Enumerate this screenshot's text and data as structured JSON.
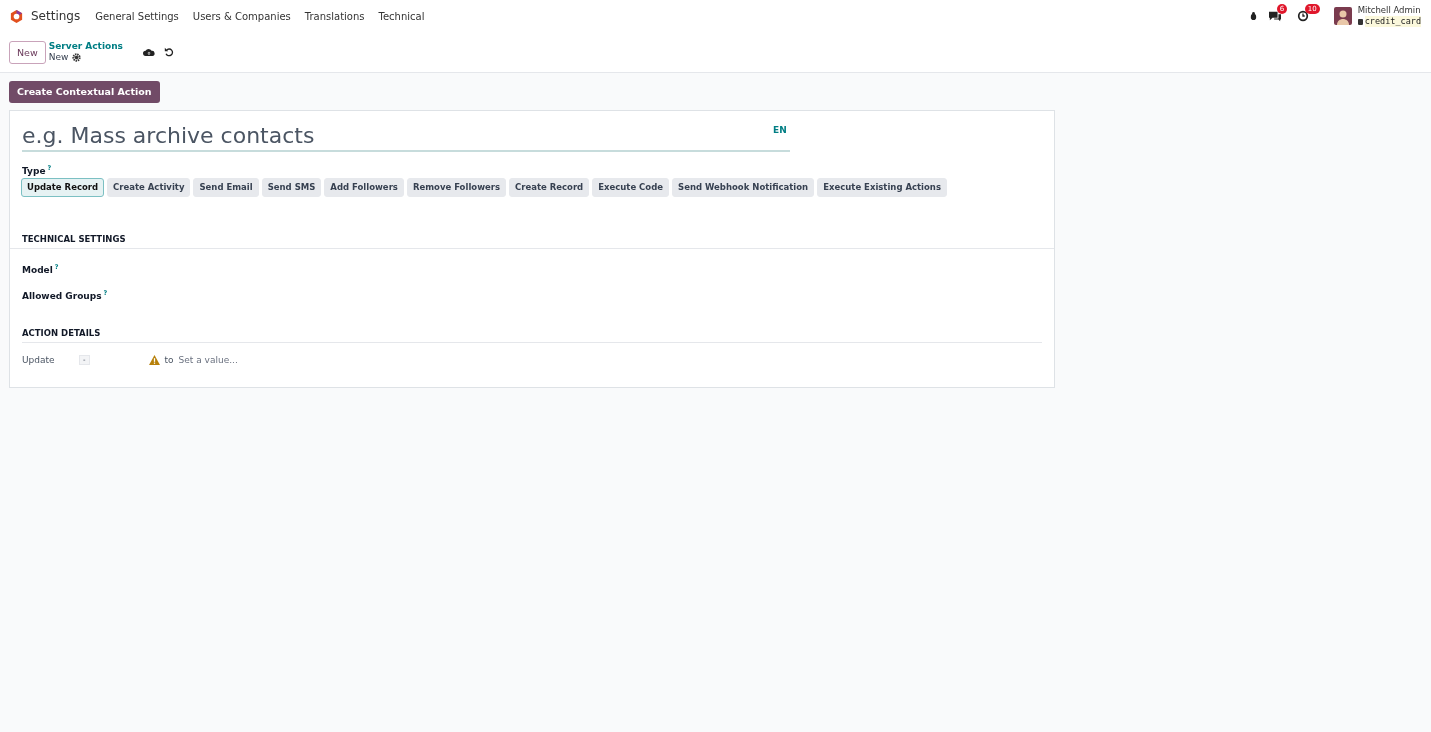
{
  "navbar": {
    "app_name": "Settings",
    "menu": [
      "General Settings",
      "Users & Companies",
      "Translations",
      "Technical"
    ],
    "messages_badge": "6",
    "activities_badge": "10",
    "user_name": "Mitchell Admin",
    "database": "credit_card"
  },
  "control_panel": {
    "new_button": "New",
    "breadcrumb": "Server Actions",
    "record": "New"
  },
  "contextual_button": "Create Contextual Action",
  "form": {
    "name_placeholder": "e.g. Mass archive contacts",
    "lang": "EN",
    "type_label": "Type",
    "help": "?",
    "types": [
      {
        "label": "Update Record",
        "selected": true
      },
      {
        "label": "Create Activity",
        "selected": false
      },
      {
        "label": "Send Email",
        "selected": false
      },
      {
        "label": "Send SMS",
        "selected": false
      },
      {
        "label": "Add Followers",
        "selected": false
      },
      {
        "label": "Remove Followers",
        "selected": false
      },
      {
        "label": "Create Record",
        "selected": false
      },
      {
        "label": "Execute Code",
        "selected": false
      },
      {
        "label": "Send Webhook Notification",
        "selected": false
      },
      {
        "label": "Execute Existing Actions",
        "selected": false
      }
    ],
    "technical_title": "TECHNICAL SETTINGS",
    "technical_fields": [
      {
        "label": "Model",
        "help": "?"
      },
      {
        "label": "Allowed Groups",
        "help": "?"
      }
    ],
    "details_title": "ACTION DETAILS",
    "update_label": "Update",
    "update_select": "-",
    "to": "to",
    "value_placeholder": "Set a value..."
  }
}
